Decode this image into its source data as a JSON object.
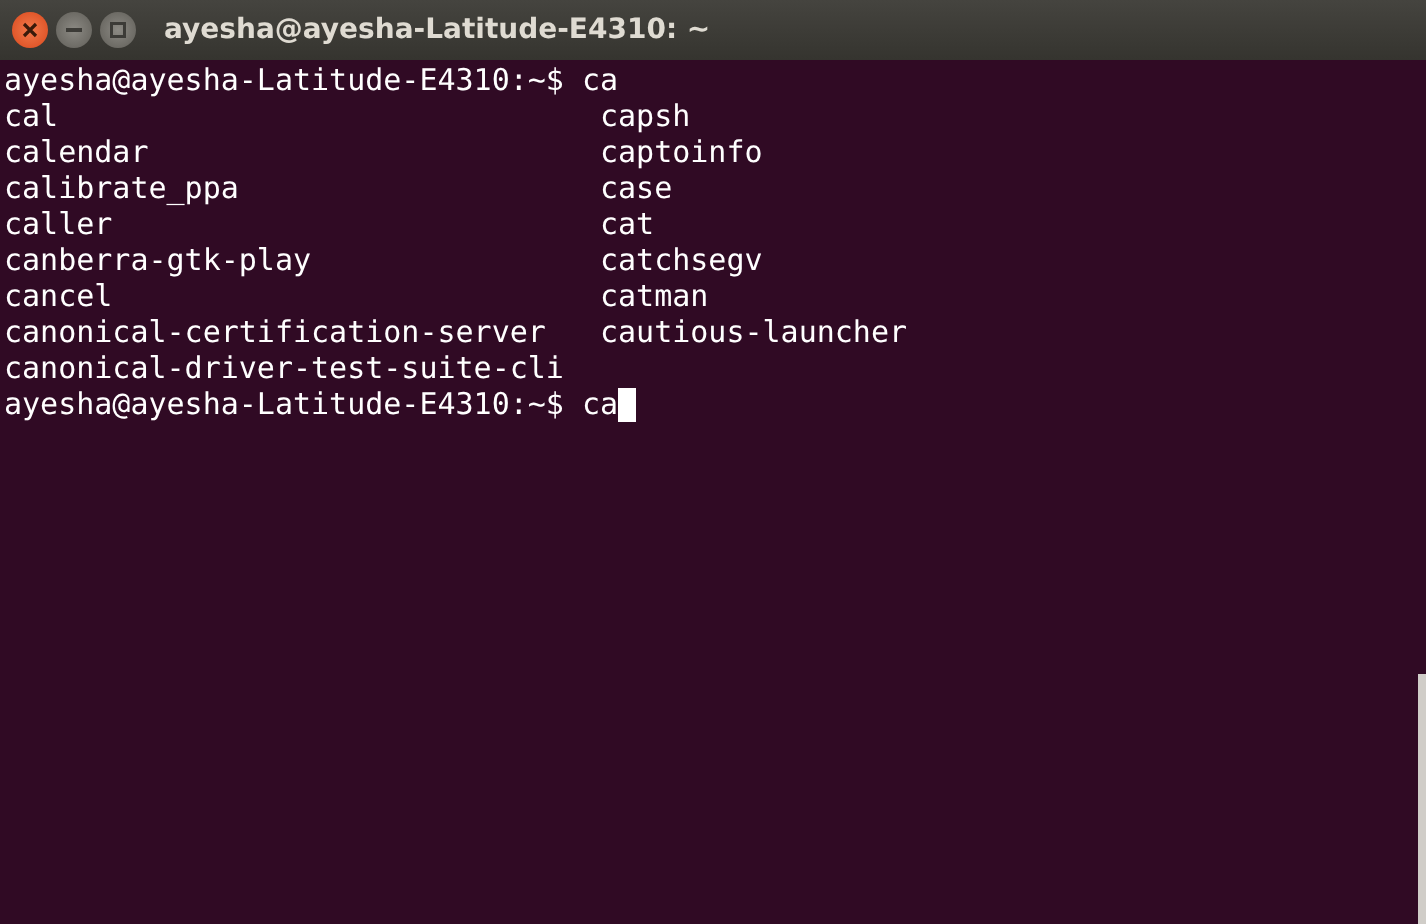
{
  "window": {
    "title": "ayesha@ayesha-Latitude-E4310: ~"
  },
  "terminal": {
    "lines": [
      {
        "kind": "prompt",
        "prompt": "ayesha@ayesha-Latitude-E4310:~$",
        "command": "ca",
        "cursor": false
      },
      {
        "kind": "columns",
        "cells": [
          "cal",
          "capsh"
        ]
      },
      {
        "kind": "columns",
        "cells": [
          "calendar",
          "captoinfo"
        ]
      },
      {
        "kind": "columns",
        "cells": [
          "calibrate_ppa",
          "case"
        ]
      },
      {
        "kind": "columns",
        "cells": [
          "caller",
          "cat"
        ]
      },
      {
        "kind": "columns",
        "cells": [
          "canberra-gtk-play",
          "catchsegv"
        ]
      },
      {
        "kind": "columns",
        "cells": [
          "cancel",
          "catman"
        ]
      },
      {
        "kind": "columns",
        "cells": [
          "canonical-certification-server",
          "cautious-launcher"
        ]
      },
      {
        "kind": "columns",
        "cells": [
          "canonical-driver-test-suite-cli"
        ]
      },
      {
        "kind": "prompt",
        "prompt": "ayesha@ayesha-Latitude-E4310:~$",
        "command": "ca",
        "cursor": true
      }
    ]
  }
}
